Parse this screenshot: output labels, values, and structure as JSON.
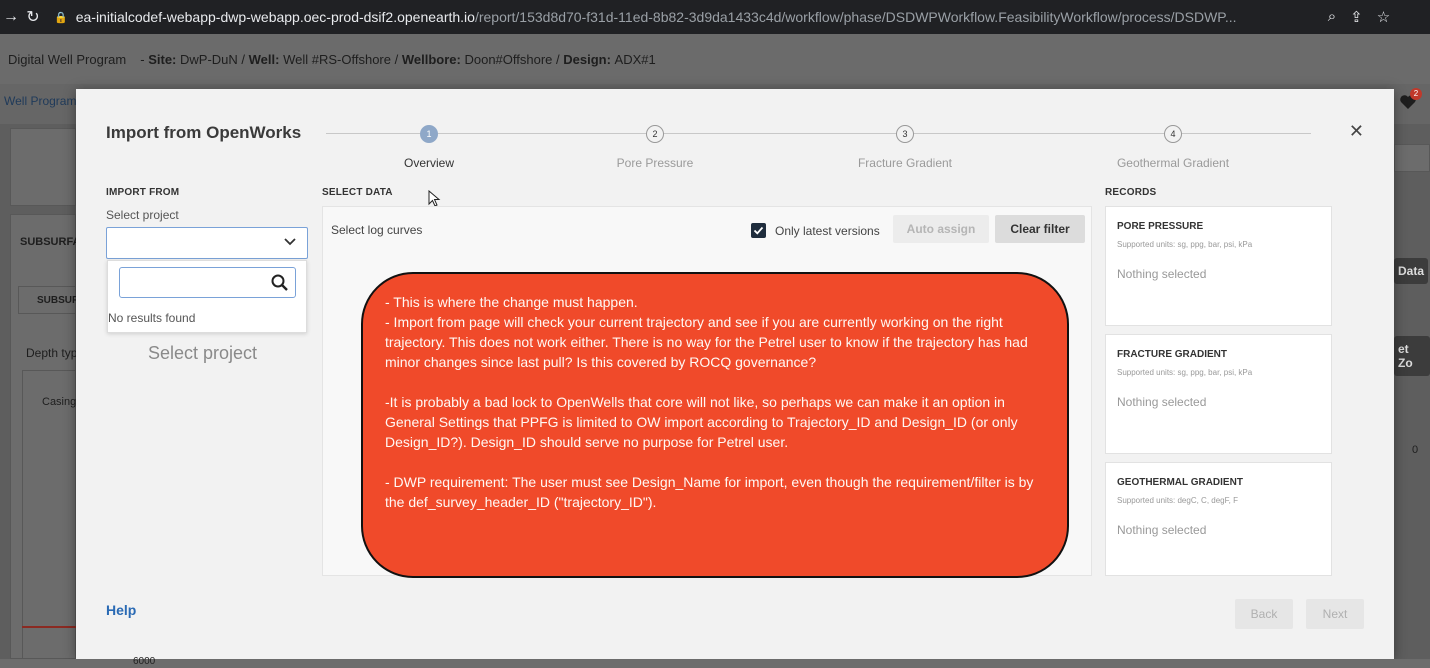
{
  "browser": {
    "url_host": "ea-initialcodef-webapp-dwp-webapp.oec-prod-dsif2.openearth.io",
    "url_path": "/report/153d8d70-f31d-11ed-8b82-3d9da1433c4d/workflow/phase/DSDWPWorkflow.FeasibilityWorkflow/process/DSDWP..."
  },
  "app": {
    "name": "Digital Well Program",
    "site_label": "Site:",
    "site_value": "DwP-DuN",
    "well_label": "Well:",
    "well_value": "Well #RS-Offshore",
    "wellbore_label": "Wellbore:",
    "wellbore_value": "Doon#Offshore",
    "design_label": "Design:",
    "design_value": "ADX#1",
    "sub_nav": "Well Program",
    "notification_count": "2",
    "bg_subsurface": "SUBSURFA",
    "bg_subsurface_tab": "SUBSUR",
    "bg_depth": "Depth typ",
    "bg_casing": "Casing",
    "bg_data_btn": "Data",
    "bg_reset_btn": "et Zo",
    "bg_zero": "0",
    "bg_depth_value": "6000"
  },
  "modal": {
    "title": "Import from OpenWorks",
    "steps": [
      {
        "num": "1",
        "label": "Overview"
      },
      {
        "num": "2",
        "label": "Pore Pressure"
      },
      {
        "num": "3",
        "label": "Fracture Gradient"
      },
      {
        "num": "4",
        "label": "Geothermal Gradient"
      }
    ],
    "import_from": {
      "heading": "IMPORT FROM",
      "field_label": "Select project",
      "no_results": "No results found",
      "placeholder": "Select project"
    },
    "select_data": {
      "heading": "SELECT DATA",
      "log_curves_label": "Select log curves",
      "only_latest_label": "Only latest versions",
      "auto_assign_label": "Auto assign",
      "clear_filter_label": "Clear filter"
    },
    "records": {
      "heading": "RECORDS",
      "items": [
        {
          "title": "PORE PRESSURE",
          "units": "Supported units: sg, ppg, bar, psi, kPa",
          "status": "Nothing selected"
        },
        {
          "title": "FRACTURE GRADIENT",
          "units": "Supported units: sg, ppg, bar, psi, kPa",
          "status": "Nothing selected"
        },
        {
          "title": "GEOTHERMAL GRADIENT",
          "units": "Supported units: degC, C, degF, F",
          "status": "Nothing selected"
        }
      ]
    },
    "help_label": "Help",
    "back_label": "Back",
    "next_label": "Next"
  },
  "annotation": {
    "line1": "- This is where the change must happen.",
    "line2": "- Import from page will check your current trajectory and see if you are currently working on the right trajectory. This does not work either. There is no way for the Petrel user to know if the trajectory has had minor changes since last pull? Is this covered by ROCQ governance?",
    "line3": "-It is probably a bad lock to OpenWells that core will not like, so perhaps we can make it an option in General Settings that PPFG is limited to OW import according to Trajectory_ID and Design_ID (or only Design_ID?). Design_ID should serve no purpose for Petrel user.",
    "line4": "- DWP requirement: The user must see Design_Name for import, even though the requirement/filter is by the def_survey_header_ID (\"trajectory_ID\")."
  }
}
